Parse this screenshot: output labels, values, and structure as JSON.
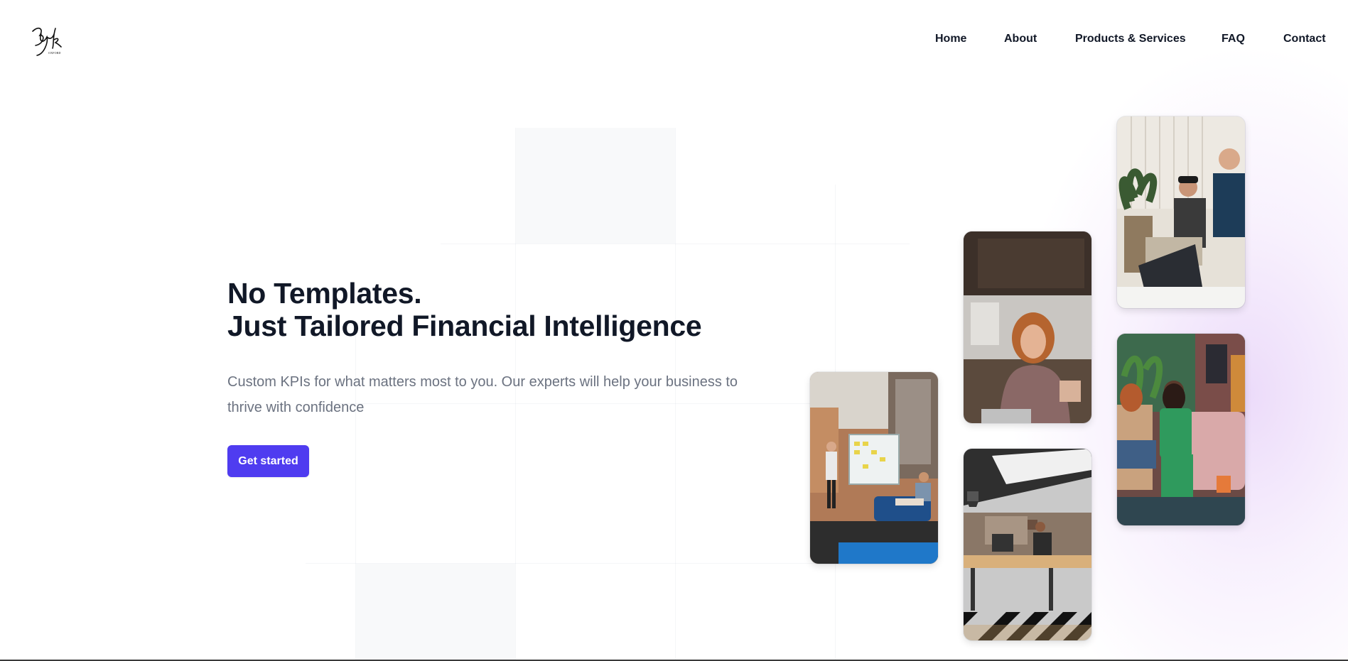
{
  "brand": {
    "logo_text": "3yk",
    "logo_subtext": "OXFORD"
  },
  "nav": {
    "items": [
      {
        "label": "Home"
      },
      {
        "label": "About"
      },
      {
        "label": "Products & Services"
      },
      {
        "label": "FAQ"
      },
      {
        "label": "Contact"
      }
    ]
  },
  "hero": {
    "title_line1": "No Templates.",
    "title_line2": "Just Tailored Financial Intelligence",
    "subtitle": "Custom KPIs for what matters most to you. Our experts will help your business to thrive with confidence",
    "cta_label": "Get started"
  },
  "photos": [
    {
      "subject": "team-whiteboard-meeting-photo"
    },
    {
      "subject": "woman-with-laptop-photo"
    },
    {
      "subject": "open-office-workspace-photo"
    },
    {
      "subject": "two-men-at-laptop-photo"
    },
    {
      "subject": "women-chatting-on-sofa-photo"
    }
  ],
  "colors": {
    "accent": "#4f3cf0",
    "heading": "#111827",
    "body_text": "#6b7280",
    "glow": "#e6d3f7"
  }
}
